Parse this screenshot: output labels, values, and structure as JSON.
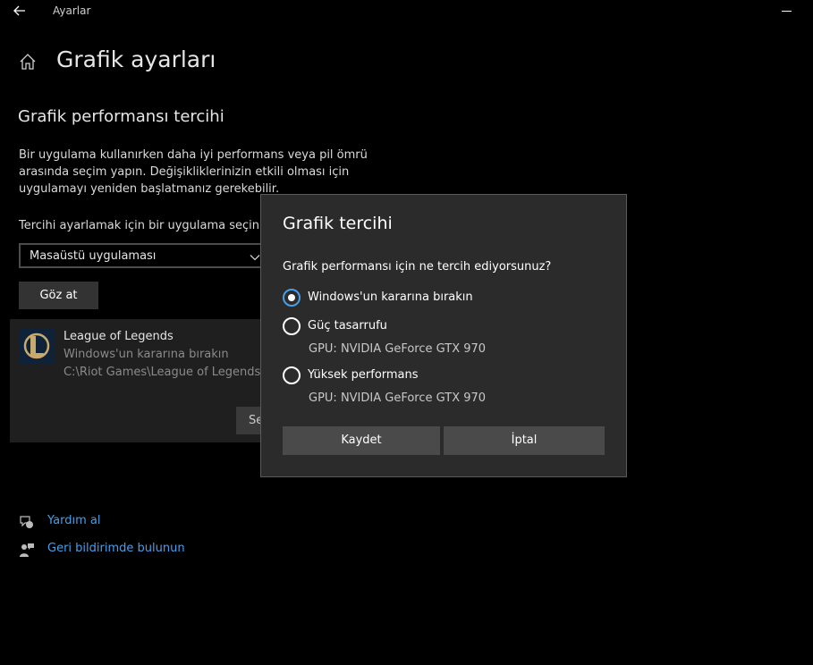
{
  "window": {
    "title": "Ayarlar"
  },
  "page": {
    "title": "Grafik ayarları"
  },
  "section": {
    "title": "Grafik performansı tercihi",
    "description": "Bir uygulama kullanırken daha iyi performans veya pil ömrü arasında seçim yapın. Değişikliklerinizin etkili olması için uygulamayı yeniden başlatmanız gerekebilir."
  },
  "selector": {
    "label": "Tercihi ayarlamak için bir uygulama seçin",
    "value": "Masaüstü uygulaması",
    "browse_label": "Göz at"
  },
  "app": {
    "name": "League of Legends",
    "preference": "Windows'un kararına bırakın",
    "path": "C:\\Riot Games\\League of Legends\\L",
    "button_partial": "Se"
  },
  "links": {
    "help": "Yardım al",
    "feedback": "Geri bildirimde bulunun"
  },
  "dialog": {
    "title": "Grafik tercihi",
    "question": "Grafik performansı için ne tercih ediyorsunuz?",
    "options": [
      {
        "label": "Windows'un kararına bırakın",
        "selected": true,
        "gpu": ""
      },
      {
        "label": "Güç tasarrufu",
        "selected": false,
        "gpu": "GPU: NVIDIA GeForce GTX 970"
      },
      {
        "label": "Yüksek performans",
        "selected": false,
        "gpu": "GPU: NVIDIA GeForce GTX 970"
      }
    ],
    "save_label": "Kaydet",
    "cancel_label": "İptal"
  },
  "colors": {
    "accent": "#4a9ee8",
    "background": "#000000",
    "dialog": "#2b2b2b"
  },
  "icons": [
    "back-arrow-icon",
    "minimize-icon",
    "home-icon",
    "chevron-down-icon",
    "league-of-legends-icon",
    "help-icon",
    "feedback-icon"
  ]
}
